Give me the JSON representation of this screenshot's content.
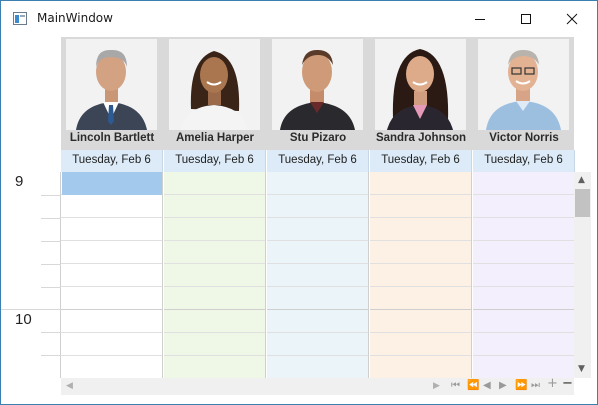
{
  "window": {
    "title": "MainWindow"
  },
  "resources": [
    {
      "name": "Lincoln Bartlett",
      "date": "Tuesday, Feb 6",
      "color": "#ffffff"
    },
    {
      "name": "Amelia Harper",
      "date": "Tuesday, Feb 6",
      "color": "#eff7e6"
    },
    {
      "name": "Stu Pizaro",
      "date": "Tuesday, Feb 6",
      "color": "#ebf4f9"
    },
    {
      "name": "Sandra Johnson",
      "date": "Tuesday, Feb 6",
      "color": "#fdf0e4"
    },
    {
      "name": "Victor Norris",
      "date": "Tuesday, Feb 6",
      "color": "#f4effd"
    }
  ],
  "time_ruler": {
    "hours": [
      "9",
      "10"
    ]
  },
  "colors": {
    "selection": "#a3c9ec",
    "date_header": "#dcebf7",
    "window_border": "#3c7fb1"
  },
  "icons": {
    "minimize": "minimize-icon",
    "maximize": "maximize-icon",
    "close": "close-icon"
  }
}
